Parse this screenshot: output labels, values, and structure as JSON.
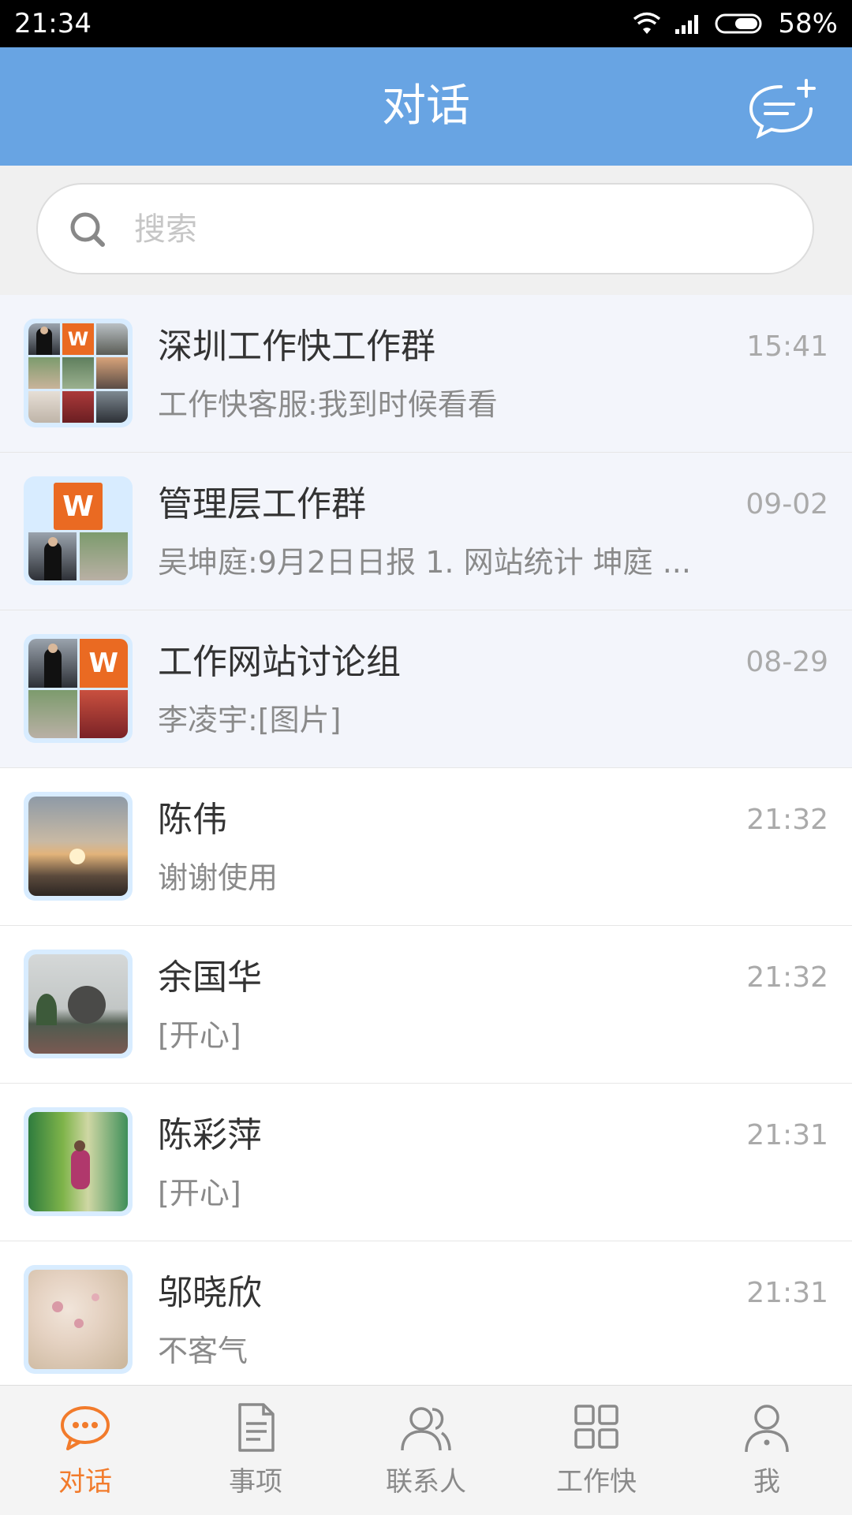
{
  "status_bar": {
    "time": "21:34",
    "battery": "58%"
  },
  "header": {
    "title": "对话",
    "new_chat_icon": "new-chat-icon"
  },
  "search": {
    "placeholder": "搜索"
  },
  "colors": {
    "accent": "#68a4e3",
    "active_tab": "#f27b2b",
    "logo": "#ea6a22"
  },
  "conversations": [
    {
      "name": "深圳工作快工作群",
      "preview": "工作快客服:我到时候看看",
      "time": "15:41",
      "pinned": true,
      "avatar": "group-9"
    },
    {
      "name": "管理层工作群",
      "preview": "吴坤庭:9月2日日报  1. 网站统计    坤庭 ...",
      "time": "09-02",
      "pinned": true,
      "avatar": "group-4"
    },
    {
      "name": "工作网站讨论组",
      "preview": "李凌宇:[图片]",
      "time": "08-29",
      "pinned": true,
      "avatar": "group-4"
    },
    {
      "name": "陈伟",
      "preview": "谢谢使用",
      "time": "21:32",
      "pinned": false,
      "avatar": "photo-sunset"
    },
    {
      "name": "余国华",
      "preview": "[开心]",
      "time": "21:32",
      "pinned": false,
      "avatar": "photo-sculpture"
    },
    {
      "name": "陈彩萍",
      "preview": "[开心]",
      "time": "21:31",
      "pinned": false,
      "avatar": "photo-person"
    },
    {
      "name": "邬晓欣",
      "preview": "不客气",
      "time": "21:31",
      "pinned": false,
      "avatar": "photo-flower"
    }
  ],
  "tabs": [
    {
      "label": "对话",
      "icon": "chat-bubble-icon",
      "active": true
    },
    {
      "label": "事项",
      "icon": "document-icon",
      "active": false
    },
    {
      "label": "联系人",
      "icon": "contacts-icon",
      "active": false
    },
    {
      "label": "工作快",
      "icon": "apps-grid-icon",
      "active": false
    },
    {
      "label": "我",
      "icon": "profile-icon",
      "active": false
    }
  ]
}
